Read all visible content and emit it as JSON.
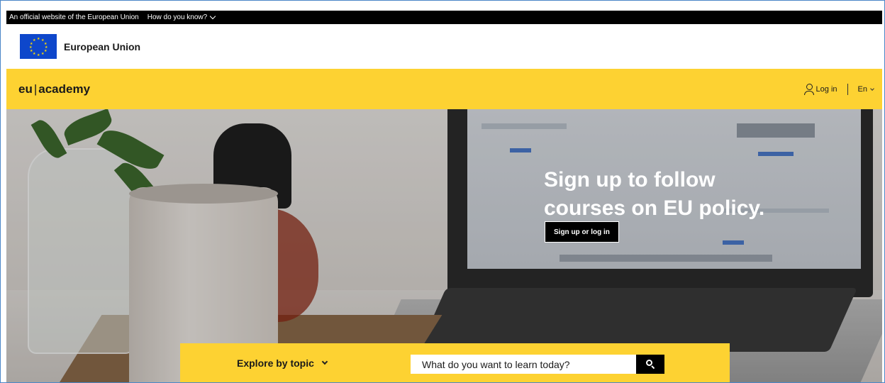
{
  "official_bar": {
    "text": "An official website of the European Union",
    "how_link": "How do you know?"
  },
  "eu_header": {
    "name": "European Union"
  },
  "academy_bar": {
    "logo_left": "eu",
    "logo_sep": "|",
    "logo_right": "academy",
    "login_label": "Log in",
    "language": "En",
    "accent_color": "#fdd232"
  },
  "hero": {
    "title_line1": "Sign up to follow",
    "title_line2": "courses on EU policy.",
    "cta_label": "Sign up or log in"
  },
  "explore_bar": {
    "topic_label": "Explore by topic",
    "search_placeholder": "What do you want to learn today?"
  }
}
